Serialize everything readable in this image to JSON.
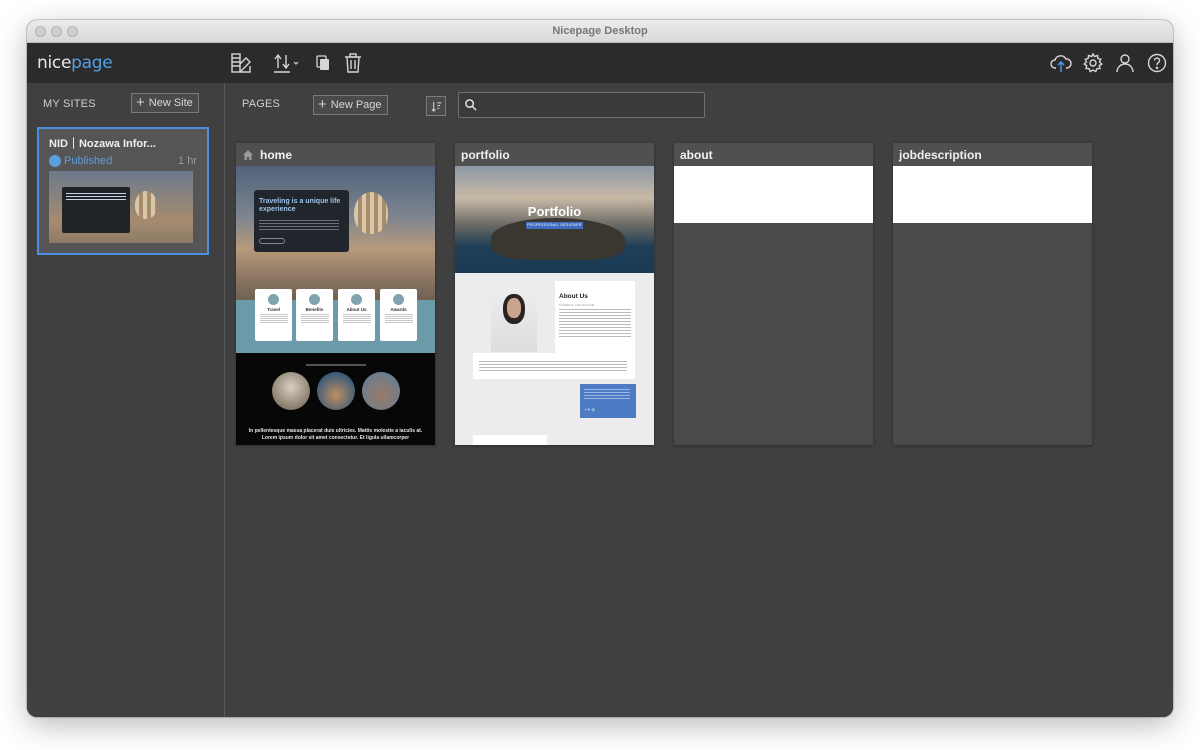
{
  "window": {
    "title": "Nicepage Desktop"
  },
  "toolbar": {
    "logo_main": "nice",
    "logo_accent": "page",
    "icons": [
      "theme-colors-icon",
      "import-export-icon",
      "duplicate-icon",
      "trash-icon",
      "cloud-upload-icon",
      "gear-icon",
      "user-icon",
      "help-icon"
    ]
  },
  "sidebar": {
    "section_label": "MY SITES",
    "new_site_label": "New Site",
    "sites": [
      {
        "name": "NID｜Nozawa Infor...",
        "status": "Published",
        "time": "1 hr"
      }
    ]
  },
  "main": {
    "section_label": "PAGES",
    "new_page_label": "New Page",
    "search": {
      "value": "",
      "placeholder": ""
    },
    "pages": [
      {
        "name": "home",
        "is_home": true,
        "preview": {
          "hero_heading": "Traveling is a unique life experience",
          "features": [
            "Travel",
            "Benefits",
            "About Us",
            "Awards"
          ],
          "footer_text": "In pellentesque massa placerat duis ultricies. Mattis molestie a iaculis at. Lorem ipsum dolor sit amet consectetur. Et ligula ullamcorper"
        }
      },
      {
        "name": "portfolio",
        "is_home": false,
        "preview": {
          "hero_title": "Portfolio",
          "hero_badge": "PROFESSIONAL DESIGNER",
          "about_heading": "About Us",
          "about_sub": "SAMPLE HEADLINE"
        }
      },
      {
        "name": "about",
        "is_home": false
      },
      {
        "name": "jobdescription",
        "is_home": false
      }
    ]
  },
  "colors": {
    "accent": "#4a90e2",
    "logo_accent": "#4fa0e8",
    "published": "#5b9ee0",
    "panel": "#404040",
    "toolbar": "#2b2b2b"
  }
}
